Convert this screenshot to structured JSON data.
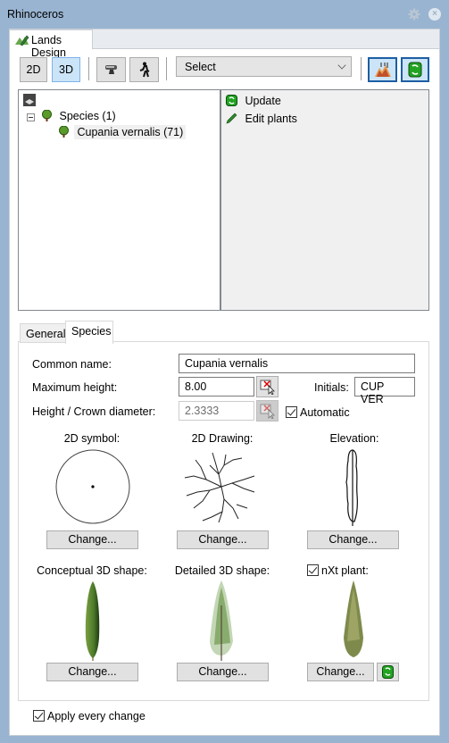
{
  "window": {
    "title": "Rhinoceros"
  },
  "panel_tab": {
    "label": "Lands Design"
  },
  "toolbar": {
    "btn_2d": "2D",
    "btn_3d": "3D",
    "select_value": "Select"
  },
  "tree": {
    "root_label": "Species (1)",
    "child_label": "Cupania vernalis (71)"
  },
  "actions": [
    {
      "label": "Update"
    },
    {
      "label": "Edit plants"
    }
  ],
  "tabs": {
    "general": "General",
    "species": "Species"
  },
  "form": {
    "common_name_label": "Common name:",
    "common_name_value": "Cupania vernalis",
    "max_height_label": "Maximum height:",
    "max_height_value": "8.00",
    "initials_label": "Initials:",
    "initials_value": "CUP VER",
    "ratio_label": "Height / Crown diameter:",
    "ratio_value": "2.3333",
    "automatic_label": "Automatic",
    "automatic_checked": true
  },
  "previews": {
    "symbol_2d": "2D symbol:",
    "drawing_2d": "2D Drawing:",
    "elevation": "Elevation:",
    "conceptual_3d": "Conceptual 3D shape:",
    "detailed_3d": "Detailed 3D shape:",
    "nxt_plant": "nXt plant:",
    "nxt_checked": true,
    "change_label": "Change..."
  },
  "footer": {
    "apply_label": "Apply every change",
    "apply_checked": true
  },
  "colors": {
    "titlebar": "#99b4d1",
    "active_button": "#cce4f7",
    "accent_border": "#1d5ea3",
    "plant_green": "#4c7a2a"
  }
}
